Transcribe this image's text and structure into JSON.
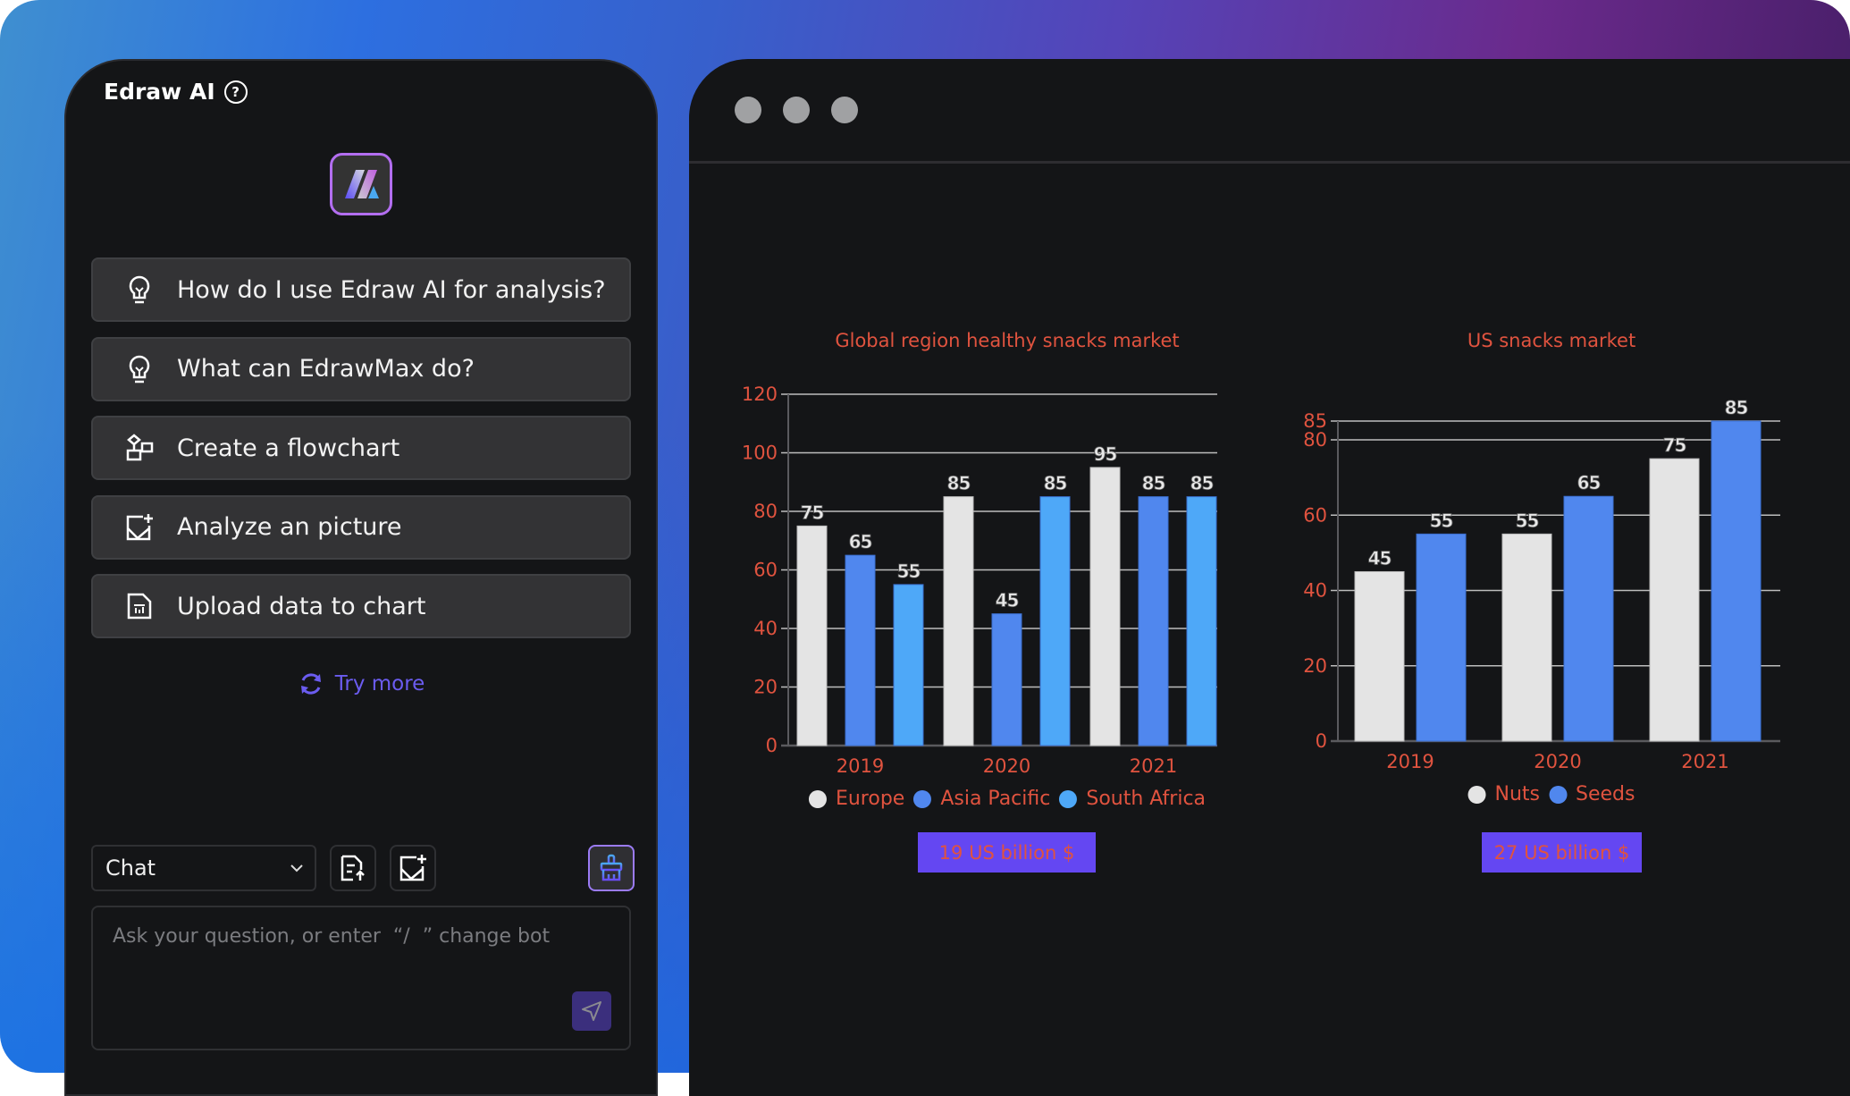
{
  "panel": {
    "title": "Edraw AI",
    "help_icon": "help-circle-icon",
    "suggestions": [
      {
        "icon": "lightbulb-icon",
        "label": "How do I use Edraw AI for analysis?"
      },
      {
        "icon": "lightbulb-icon",
        "label": "What can EdrawMax do?"
      },
      {
        "icon": "flowchart-icon",
        "label": "Create a flowchart"
      },
      {
        "icon": "image-add-icon",
        "label": "Analyze an picture"
      },
      {
        "icon": "chart-file-icon",
        "label": "Upload data to chart"
      }
    ],
    "try_more": "Try more",
    "mode_select": {
      "value": "Chat"
    },
    "input": {
      "placeholder": "Ask your question, or enter  “/  ” change bot",
      "value": ""
    }
  },
  "colors": {
    "accent": "#6447f2",
    "chart_text": "#e0533f",
    "series_light": "#e4e4e4",
    "series_blue": "#5087ee",
    "series_sky": "#4ea8f8"
  },
  "chart_data": [
    {
      "type": "bar",
      "title": "Global region healthy snacks market",
      "categories": [
        "2019",
        "2020",
        "2021"
      ],
      "series": [
        {
          "name": "Europe",
          "color": "#e4e4e4",
          "values": [
            75,
            85,
            95
          ]
        },
        {
          "name": "Asia Pacific",
          "color": "#5087ee",
          "values": [
            65,
            45,
            85
          ]
        },
        {
          "name": "South Africa",
          "color": "#4ea8f8",
          "values": [
            55,
            85,
            85
          ]
        }
      ],
      "yticks": [
        0,
        20,
        40,
        60,
        80,
        100,
        120
      ],
      "ylim": [
        0,
        120
      ],
      "grid": true,
      "legend": "bottom",
      "xlabel": "",
      "ylabel": "",
      "footer_badge": "19 US billion $"
    },
    {
      "type": "bar",
      "title": "US snacks market",
      "categories": [
        "2019",
        "2020",
        "2021"
      ],
      "series": [
        {
          "name": "Nuts",
          "color": "#e4e4e4",
          "values": [
            45,
            55,
            75
          ]
        },
        {
          "name": "Seeds",
          "color": "#5087ee",
          "values": [
            55,
            65,
            85
          ]
        }
      ],
      "yticks": [
        0,
        20,
        40,
        60,
        80,
        85
      ],
      "ylim": [
        0,
        85
      ],
      "grid": true,
      "legend": "bottom",
      "xlabel": "",
      "ylabel": "",
      "footer_badge": "27 US billion $"
    }
  ]
}
